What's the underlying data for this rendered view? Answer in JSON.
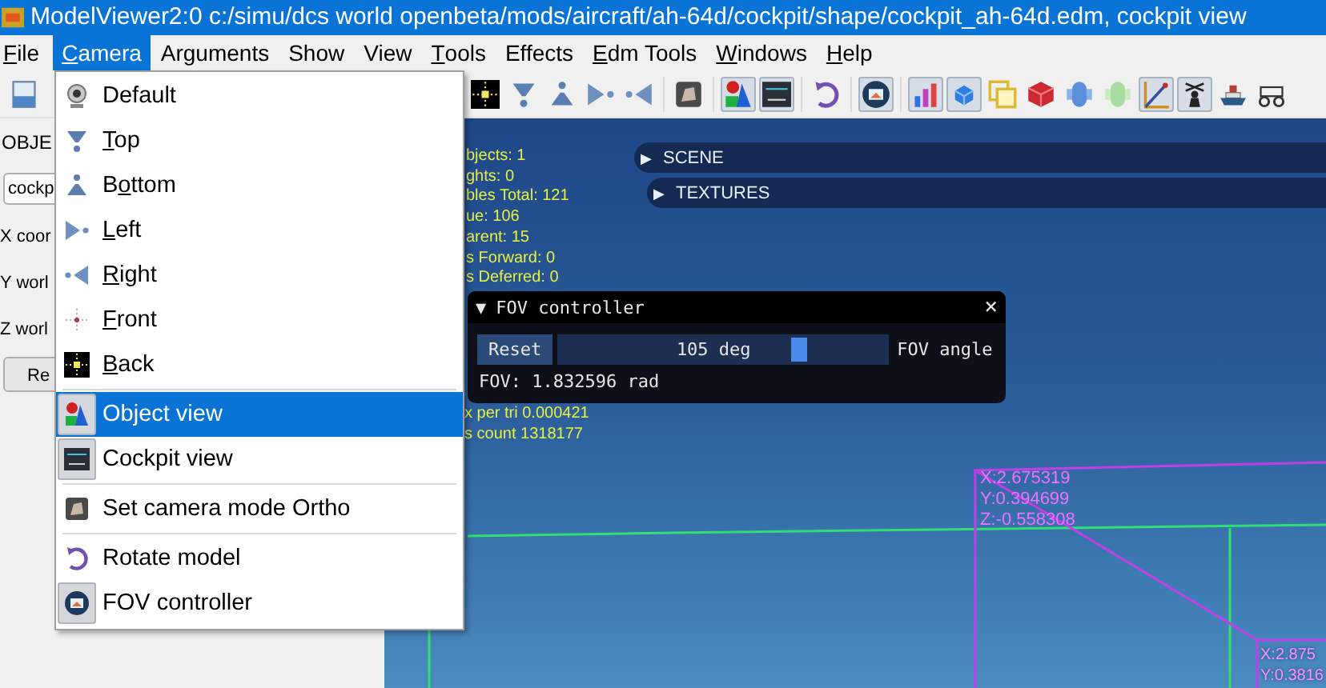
{
  "window": {
    "title": "ModelViewer2:0 c:/simu/dcs world openbeta/mods/aircraft/ah-64d/cockpit/shape/cockpit_ah-64d.edm, cockpit view"
  },
  "menubar": [
    {
      "accel": "F",
      "rest": "ile",
      "selected": false
    },
    {
      "accel": "C",
      "rest": "amera",
      "selected": true
    },
    {
      "label": "Arguments",
      "selected": false
    },
    {
      "label": "Show",
      "selected": false
    },
    {
      "label": "View",
      "selected": false
    },
    {
      "accel": "T",
      "rest": "ools",
      "selected": false
    },
    {
      "label": "Effects",
      "selected": false
    },
    {
      "accel": "E",
      "rest": "dm Tools",
      "selected": false
    },
    {
      "accel": "W",
      "rest": "indows",
      "selected": false
    },
    {
      "accel": "H",
      "rest": "elp",
      "selected": false
    }
  ],
  "toolbar": {
    "groups": [
      [
        {
          "kind": "document",
          "pressed": false
        }
      ],
      [
        {
          "kind": "back",
          "pressed": false
        },
        {
          "kind": "funnel-down",
          "pressed": false
        },
        {
          "kind": "funnel-up",
          "pressed": false
        },
        {
          "kind": "arrow-right",
          "pressed": false
        },
        {
          "kind": "arrow-left",
          "pressed": false
        }
      ],
      [
        {
          "kind": "tile",
          "pressed": false
        }
      ],
      [
        {
          "kind": "shapes",
          "pressed": true
        },
        {
          "kind": "panel",
          "pressed": true
        }
      ],
      [
        {
          "kind": "rotate",
          "pressed": false
        }
      ],
      [
        {
          "kind": "screen",
          "pressed": true
        }
      ],
      [
        {
          "kind": "bar-chart",
          "pressed": true
        },
        {
          "kind": "cube",
          "pressed": true
        },
        {
          "kind": "outline-cube",
          "pressed": false
        },
        {
          "kind": "red-cube",
          "pressed": false
        },
        {
          "kind": "capsule",
          "pressed": false
        },
        {
          "kind": "capsule-pale",
          "pressed": false
        },
        {
          "kind": "axes",
          "pressed": true
        },
        {
          "kind": "figure",
          "pressed": true
        },
        {
          "kind": "ship",
          "pressed": false
        },
        {
          "kind": "wheels",
          "pressed": false
        }
      ]
    ]
  },
  "camera_menu": {
    "groups": [
      [
        {
          "kind": "webcam",
          "label": "Default",
          "selected": false,
          "checked": false
        },
        {
          "kind": "funnel-down",
          "accel": "T",
          "rest": "op",
          "selected": false,
          "checked": false
        },
        {
          "kind": "funnel-up",
          "pre": "B",
          "accel": "o",
          "rest": "ttom",
          "selected": false,
          "checked": false
        },
        {
          "kind": "arrow-right",
          "accel": "L",
          "rest": "eft",
          "selected": false,
          "checked": false
        },
        {
          "kind": "arrow-left",
          "accel": "R",
          "rest": "ight",
          "selected": false,
          "checked": false
        },
        {
          "kind": "front",
          "accel": "F",
          "rest": "ront",
          "selected": false,
          "checked": false
        },
        {
          "kind": "back",
          "accel": "B",
          "rest": "ack",
          "selected": false,
          "checked": false
        }
      ],
      [
        {
          "kind": "shapes",
          "label": "Object view",
          "selected": true,
          "checked": true
        },
        {
          "kind": "panel",
          "label": "Cockpit view",
          "selected": false,
          "checked": true
        }
      ],
      [
        {
          "kind": "tile",
          "label": "Set camera mode Ortho",
          "selected": false,
          "checked": false
        }
      ],
      [
        {
          "kind": "rotate",
          "label": "Rotate model",
          "selected": false,
          "checked": false
        },
        {
          "kind": "screen",
          "label": "FOV controller",
          "selected": false,
          "checked": true
        }
      ]
    ]
  },
  "object_panel": {
    "heading": "OBJE",
    "name_field": "cockp",
    "labels": [
      "X coor",
      "Y worl",
      "Z worl"
    ],
    "button": "Re"
  },
  "viewport": {
    "stats": [
      "bjects: 1",
      "ghts:  0",
      "bles Total: 121",
      "ue: 106",
      "arent: 15",
      "s Forward: 0",
      "s Deferred: 0"
    ],
    "stats_below": [
      "x per tri 0.000421",
      "s count 1318177"
    ],
    "sections": [
      {
        "arrow": "▶",
        "label": "SCENE"
      },
      {
        "arrow": "▶",
        "label": "TEXTURES"
      }
    ],
    "fov_window": {
      "arrow": "▼",
      "title": "FOV controller",
      "close": "×",
      "reset": "Reset",
      "slider_text": "105 deg",
      "level": 0.73,
      "slider_label": "FOV angle",
      "readout": "FOV: 1.832596 rad"
    },
    "point_labels": [
      [
        "X:2.675319",
        "Y:0.394699",
        "Z:-0.558308"
      ],
      [
        "X:2.875",
        "Y:0.3816"
      ]
    ]
  }
}
